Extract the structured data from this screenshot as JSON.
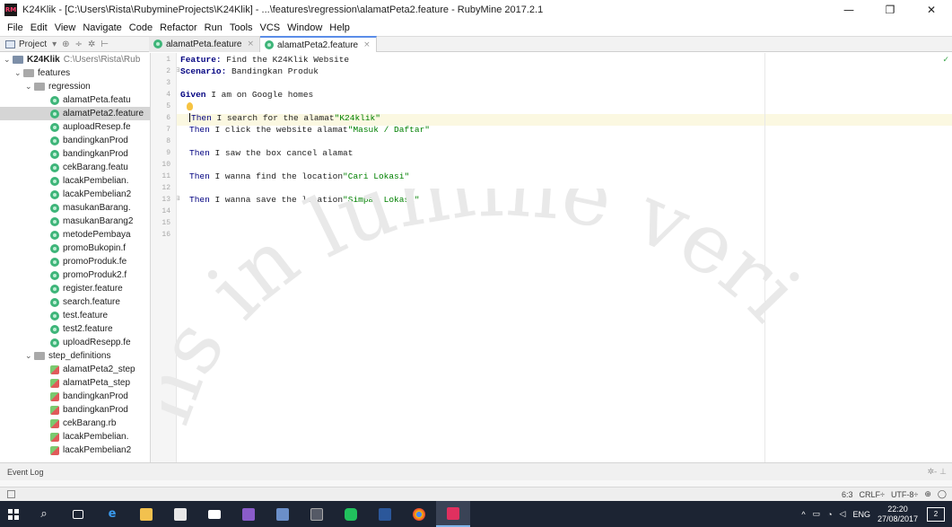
{
  "window": {
    "title": "K24Klik - [C:\\Users\\Rista\\RubymineProjects\\K24Klik] - ...\\features\\regression\\alamatPeta2.feature - RubyMine 2017.2.1",
    "app_icon_label": "RM",
    "minimize_glyph": "—",
    "maximize_glyph": "❐",
    "close_glyph": "✕"
  },
  "menu": [
    "File",
    "Edit",
    "View",
    "Navigate",
    "Code",
    "Refactor",
    "Run",
    "Tools",
    "VCS",
    "Window",
    "Help"
  ],
  "toolbar": {
    "project_label": "Project",
    "project_caret": "▾",
    "sync_glyph": "⊕",
    "split_glyph": "÷",
    "gear_glyph": "✲",
    "collapse_glyph": "⊢"
  },
  "tabs": [
    {
      "label": "alamatPeta.feature",
      "close": "×"
    },
    {
      "label": "alamatPeta2.feature",
      "close": "×"
    }
  ],
  "tree": {
    "root_label": "K24Klik",
    "root_path": "C:\\Users\\Rista\\Rub",
    "features_label": "features",
    "regression_label": "regression",
    "feature_files": [
      "alamatPeta.featu",
      "alamatPeta2.feature",
      "auploadResep.fe",
      "bandingkanProd",
      "bandingkanProd",
      "cekBarang.featu",
      "lacakPembelian.",
      "lacakPembelian2",
      "masukanBarang.",
      "masukanBarang2",
      "metodePembaya",
      "promoBukopin.f",
      "promoProduk.fe",
      "promoProduk2.f",
      "register.feature",
      "search.feature",
      "test.feature",
      "test2.feature",
      "uploadResepp.fe"
    ],
    "step_definitions_label": "step_definitions",
    "step_files": [
      "alamatPeta2_step",
      "alamatPeta_step",
      "bandingkanProd",
      "bandingkanProd",
      "cekBarang.rb",
      "lacakPembelian.",
      "lacakPembelian2"
    ]
  },
  "editor": {
    "line_numbers": [
      "1",
      "2",
      "3",
      "4",
      "5",
      "6",
      "7",
      "8",
      "9",
      "10",
      "11",
      "12",
      "13",
      "14",
      "15",
      "16"
    ],
    "lines": {
      "l1_kw": "Feature:",
      "l1_text": " Find the K24Klik Website",
      "l2_kw": "Scenario:",
      "l2_text": " Bandingkan Produk",
      "l4_kw": "Given",
      "l4_text": " I am on Google homes",
      "l6_kw": "Then",
      "l6_text": " I search for the alamat",
      "l6_str": "\"K24klik\"",
      "l7_kw": "Then",
      "l7_text": " I click the website alamat",
      "l7_str": "\"Masuk / Daftar\"",
      "l9_kw": "Then",
      "l9_text": " I saw the box cancel alamat",
      "l11_kw": "Then",
      "l11_text": " I wanna find the location",
      "l11_str": "\"Cari Lokasi\"",
      "l13_kw": "Then",
      "l13_text": " I wanna save the location",
      "l13_str": "\"Simpan Lokasi\""
    }
  },
  "event_log": {
    "label": "Event Log",
    "tools_glyph": "✲- ⊥"
  },
  "status": {
    "position": "6:3",
    "line_sep": "CRLF÷",
    "encoding": "UTF-8÷"
  },
  "taskbar": {
    "time": "22:20",
    "date": "27/08/2017",
    "lang": "ENG",
    "notif_count": "2"
  },
  "watermark_text": "ns in lumine veri",
  "colors": {
    "keyword": "#000080",
    "string": "#008000",
    "tab_accent": "#5a8de8",
    "cucumber": "#3eb579",
    "taskbar": "#1c2433"
  }
}
